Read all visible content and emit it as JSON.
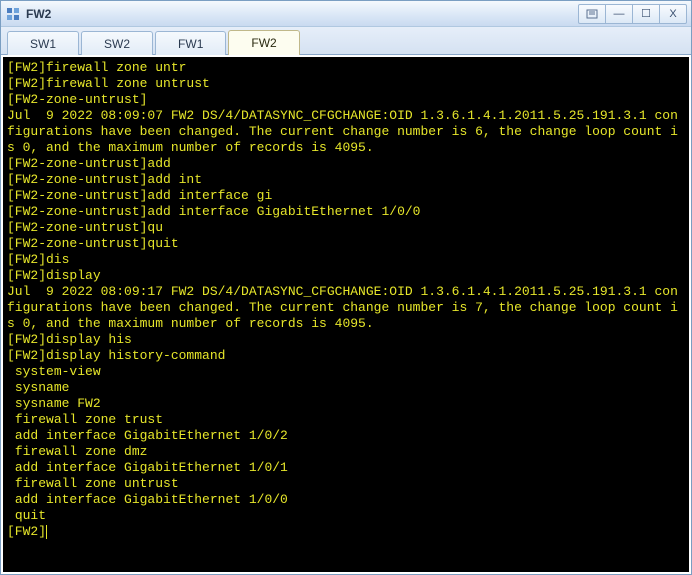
{
  "window": {
    "title": "FW2"
  },
  "controls": {
    "extra": "⎙",
    "minimize": "—",
    "maximize": "☐",
    "close": "X"
  },
  "tabs": [
    {
      "label": "SW1",
      "active": false
    },
    {
      "label": "SW2",
      "active": false
    },
    {
      "label": "FW1",
      "active": false
    },
    {
      "label": "FW2",
      "active": true
    }
  ],
  "terminal_lines": [
    "[FW2]firewall zone untr",
    "[FW2]firewall zone untrust",
    "[FW2-zone-untrust]",
    "Jul  9 2022 08:09:07 FW2 DS/4/DATASYNC_CFGCHANGE:OID 1.3.6.1.4.1.2011.5.25.191.3.1 configurations have been changed. The current change number is 6, the change loop count is 0, and the maximum number of records is 4095.",
    "[FW2-zone-untrust]add",
    "[FW2-zone-untrust]add int",
    "[FW2-zone-untrust]add interface gi",
    "[FW2-zone-untrust]add interface GigabitEthernet 1/0/0",
    "[FW2-zone-untrust]qu",
    "[FW2-zone-untrust]quit",
    "[FW2]dis",
    "[FW2]display",
    "Jul  9 2022 08:09:17 FW2 DS/4/DATASYNC_CFGCHANGE:OID 1.3.6.1.4.1.2011.5.25.191.3.1 configurations have been changed. The current change number is 7, the change loop count is 0, and the maximum number of records is 4095.",
    "[FW2]display his",
    "[FW2]display history-command",
    " system-view",
    " sysname",
    " sysname FW2",
    " firewall zone trust",
    " add interface GigabitEthernet 1/0/2",
    " firewall zone dmz",
    " add interface GigabitEthernet 1/0/1",
    " firewall zone untrust",
    " add interface GigabitEthernet 1/0/0",
    " quit",
    "[FW2]"
  ]
}
